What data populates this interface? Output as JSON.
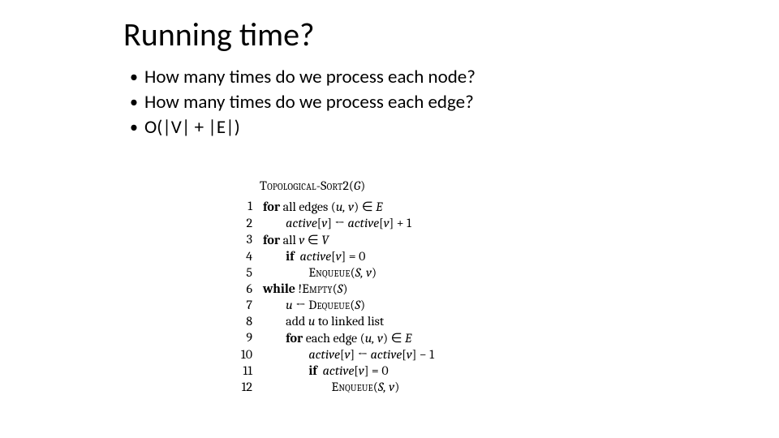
{
  "title": "Running time?",
  "bullets": [
    "How many times do we process each node?",
    "How many times do we process each edge?",
    "O(|V| + |E|)"
  ],
  "algorithm": {
    "name_sc": "Topological-Sort",
    "name_suffix": "2(",
    "name_arg": "G",
    "name_close": ")",
    "lines": [
      {
        "n": "1",
        "indent": 0,
        "parts": [
          {
            "t": "kw",
            "v": "for"
          },
          {
            "t": "txt",
            "v": " all edges ("
          },
          {
            "t": "it",
            "v": "u, v"
          },
          {
            "t": "txt",
            "v": ") ∈ "
          },
          {
            "t": "it",
            "v": "E"
          }
        ]
      },
      {
        "n": "2",
        "indent": 1,
        "parts": [
          {
            "t": "it",
            "v": "active"
          },
          {
            "t": "txt",
            "v": "["
          },
          {
            "t": "it",
            "v": "v"
          },
          {
            "t": "txt",
            "v": "] ← "
          },
          {
            "t": "it",
            "v": "active"
          },
          {
            "t": "txt",
            "v": "["
          },
          {
            "t": "it",
            "v": "v"
          },
          {
            "t": "txt",
            "v": "] + 1"
          }
        ]
      },
      {
        "n": "3",
        "indent": 0,
        "parts": [
          {
            "t": "kw",
            "v": "for"
          },
          {
            "t": "txt",
            "v": " all "
          },
          {
            "t": "it",
            "v": "v"
          },
          {
            "t": "txt",
            "v": " ∈ "
          },
          {
            "t": "it",
            "v": "V"
          }
        ]
      },
      {
        "n": "4",
        "indent": 1,
        "parts": [
          {
            "t": "kw",
            "v": "if"
          },
          {
            "t": "txt",
            "v": "  "
          },
          {
            "t": "it",
            "v": "active"
          },
          {
            "t": "txt",
            "v": "["
          },
          {
            "t": "it",
            "v": "v"
          },
          {
            "t": "txt",
            "v": "] = 0"
          }
        ]
      },
      {
        "n": "5",
        "indent": 2,
        "parts": [
          {
            "t": "sc",
            "v": "Enqueue"
          },
          {
            "t": "txt",
            "v": "("
          },
          {
            "t": "it",
            "v": "S, v"
          },
          {
            "t": "txt",
            "v": ")"
          }
        ]
      },
      {
        "n": "6",
        "indent": 0,
        "parts": [
          {
            "t": "kw",
            "v": "while"
          },
          {
            "t": "txt",
            "v": " !"
          },
          {
            "t": "sc",
            "v": "Empty"
          },
          {
            "t": "txt",
            "v": "("
          },
          {
            "t": "it",
            "v": "S"
          },
          {
            "t": "txt",
            "v": ")"
          }
        ]
      },
      {
        "n": "7",
        "indent": 1,
        "parts": [
          {
            "t": "it",
            "v": "u"
          },
          {
            "t": "txt",
            "v": " ← "
          },
          {
            "t": "sc",
            "v": "Dequeue"
          },
          {
            "t": "txt",
            "v": "("
          },
          {
            "t": "it",
            "v": "S"
          },
          {
            "t": "txt",
            "v": ")"
          }
        ]
      },
      {
        "n": "8",
        "indent": 1,
        "parts": [
          {
            "t": "txt",
            "v": "add "
          },
          {
            "t": "it",
            "v": "u"
          },
          {
            "t": "txt",
            "v": " to linked list"
          }
        ]
      },
      {
        "n": "9",
        "indent": 1,
        "parts": [
          {
            "t": "kw",
            "v": "for"
          },
          {
            "t": "txt",
            "v": " each edge ("
          },
          {
            "t": "it",
            "v": "u, v"
          },
          {
            "t": "txt",
            "v": ") ∈ "
          },
          {
            "t": "it",
            "v": "E"
          }
        ]
      },
      {
        "n": "10",
        "indent": 2,
        "parts": [
          {
            "t": "it",
            "v": "active"
          },
          {
            "t": "txt",
            "v": "["
          },
          {
            "t": "it",
            "v": "v"
          },
          {
            "t": "txt",
            "v": "] ← "
          },
          {
            "t": "it",
            "v": "active"
          },
          {
            "t": "txt",
            "v": "["
          },
          {
            "t": "it",
            "v": "v"
          },
          {
            "t": "txt",
            "v": "] − 1"
          }
        ]
      },
      {
        "n": "11",
        "indent": 2,
        "parts": [
          {
            "t": "kw",
            "v": "if"
          },
          {
            "t": "txt",
            "v": "  "
          },
          {
            "t": "it",
            "v": "active"
          },
          {
            "t": "txt",
            "v": "["
          },
          {
            "t": "it",
            "v": "v"
          },
          {
            "t": "txt",
            "v": "] = 0"
          }
        ]
      },
      {
        "n": "12",
        "indent": 3,
        "parts": [
          {
            "t": "sc",
            "v": "Enqueue"
          },
          {
            "t": "txt",
            "v": "("
          },
          {
            "t": "it",
            "v": "S, v"
          },
          {
            "t": "txt",
            "v": ")"
          }
        ]
      }
    ]
  }
}
